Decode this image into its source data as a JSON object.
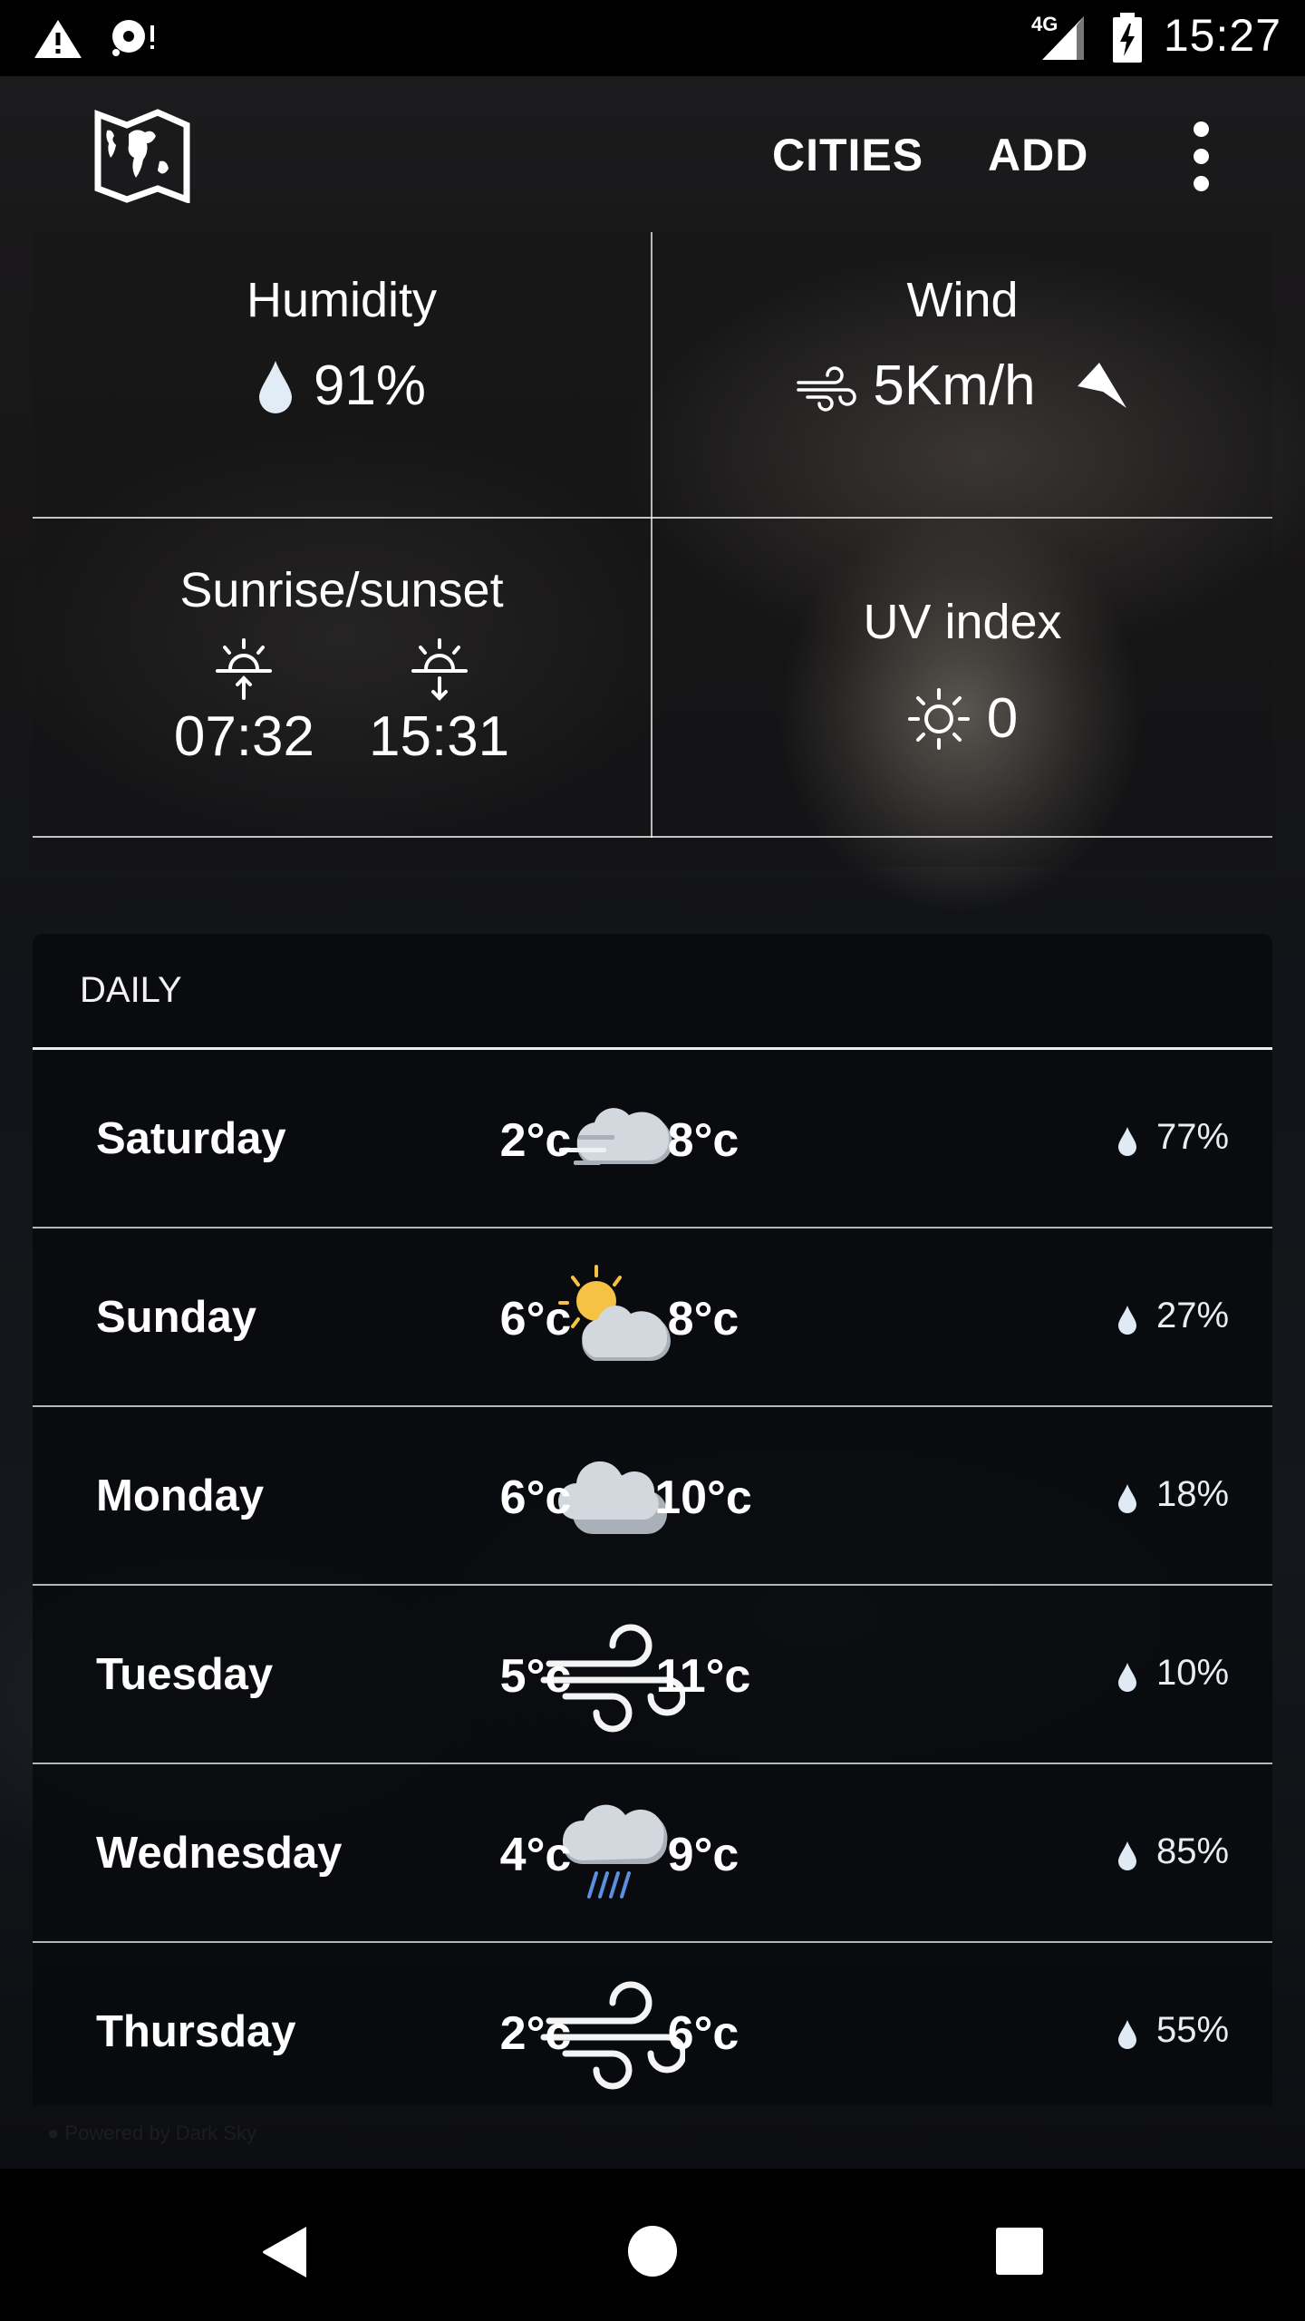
{
  "status_bar": {
    "time": "15:27",
    "network": "4G",
    "left_icons": [
      "warning-icon",
      "disc-alert-icon"
    ],
    "right_icons": [
      "signal-icon",
      "battery-charging-icon"
    ]
  },
  "app_bar": {
    "logo_icon": "world-map-icon",
    "actions": [
      {
        "label": "CITIES"
      },
      {
        "label": "ADD"
      }
    ],
    "overflow_icon": "more-vert-icon"
  },
  "details": {
    "humidity": {
      "label": "Humidity",
      "value": "91%",
      "icon": "water-drop-icon"
    },
    "wind": {
      "label": "Wind",
      "value": "5Km/h",
      "icon": "wind-icon",
      "direction_icon": "navigation-arrow-icon"
    },
    "sun": {
      "label": "Sunrise/sunset",
      "sunrise": "07:32",
      "sunset": "15:31",
      "sunrise_icon": "sunrise-icon",
      "sunset_icon": "sunset-icon"
    },
    "uv": {
      "label": "UV index",
      "value": "0",
      "icon": "sun-icon"
    }
  },
  "daily": {
    "title": "DAILY",
    "days": [
      {
        "day": "Saturday",
        "icon": "windy-cloud",
        "low": "2°c",
        "high": "8°c",
        "precip": "77%"
      },
      {
        "day": "Sunday",
        "icon": "partly-cloudy",
        "low": "6°c",
        "high": "8°c",
        "precip": "27%"
      },
      {
        "day": "Monday",
        "icon": "cloudy",
        "low": "6°c",
        "high": "10°c",
        "precip": "18%"
      },
      {
        "day": "Tuesday",
        "icon": "wind",
        "low": "5°c",
        "high": "11°c",
        "precip": "10%"
      },
      {
        "day": "Wednesday",
        "icon": "rain",
        "low": "4°c",
        "high": "9°c",
        "precip": "85%"
      },
      {
        "day": "Thursday",
        "icon": "wind",
        "low": "2°c",
        "high": "6°c",
        "precip": "55%"
      }
    ]
  },
  "footer": {
    "powered_by": "Powered by Dark Sky"
  },
  "colors": {
    "rain": "#5b8fe0",
    "sun": "#f6c244",
    "cloud": "#d3d7de",
    "cloud_shade": "#aab0b8",
    "drop": "#dfeaf5"
  }
}
